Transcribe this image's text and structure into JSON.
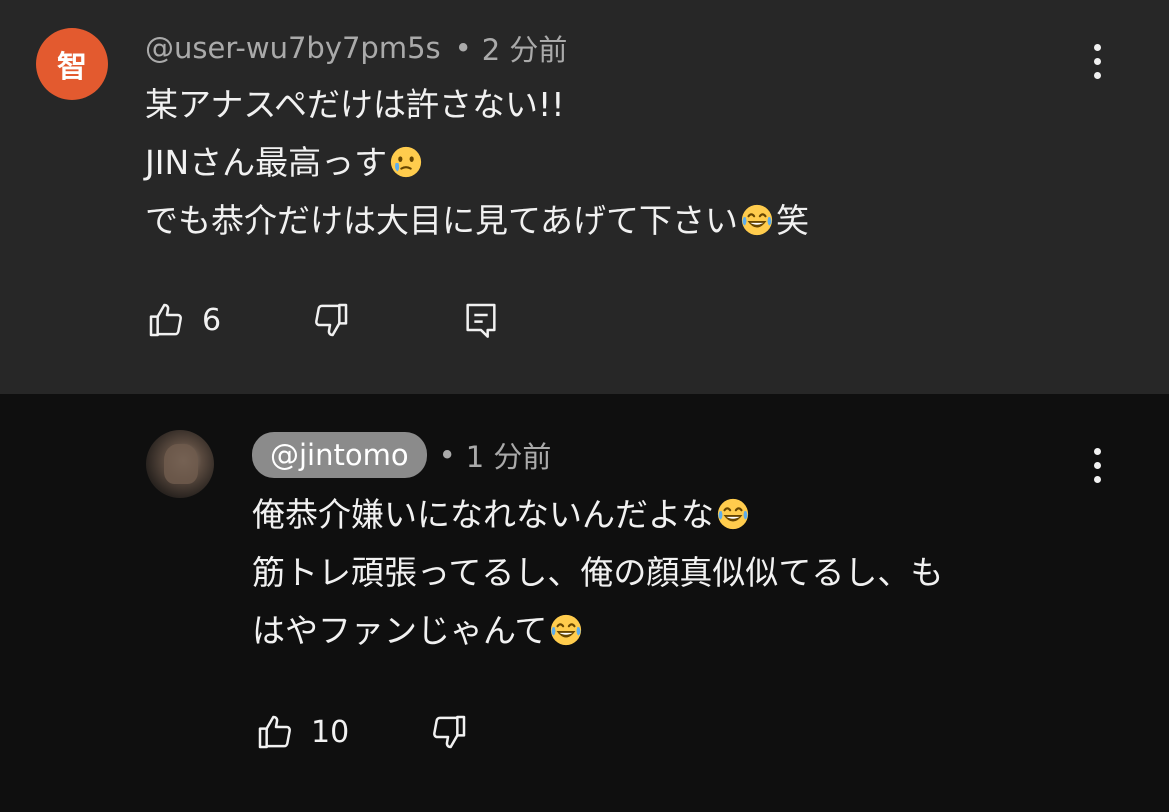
{
  "comments": [
    {
      "avatar_char": "智",
      "avatar_color": "#e35a2f",
      "handle": "@user-wu7by7pm5s",
      "separator": "•",
      "time": "2 分前",
      "lines": [
        "某アナスペだけは許さない!!",
        "JINさん最高っす",
        "でも恭介だけは大目に見てあげて下さい",
        "笑"
      ],
      "likes": "6",
      "icons": [
        "thumbs-up-icon",
        "thumbs-down-icon",
        "reply-icon",
        "more-vert-icon"
      ]
    },
    {
      "handle": "@jintomo",
      "handle_pill_color": "#8b8b8b",
      "separator": "•",
      "time": "1 分前",
      "lines": [
        "俺恭介嫌いになれないんだよな",
        "筋トレ頑張ってるし、俺の顔真似似てるし、も",
        "はやファンじゃんて"
      ],
      "likes": "10",
      "icons": [
        "thumbs-up-icon",
        "thumbs-down-icon",
        "more-vert-icon"
      ]
    }
  ],
  "colors": {
    "top_bg": "#272727",
    "bottom_bg": "#0f0f0f",
    "meta_text": "#aaaaaa"
  }
}
